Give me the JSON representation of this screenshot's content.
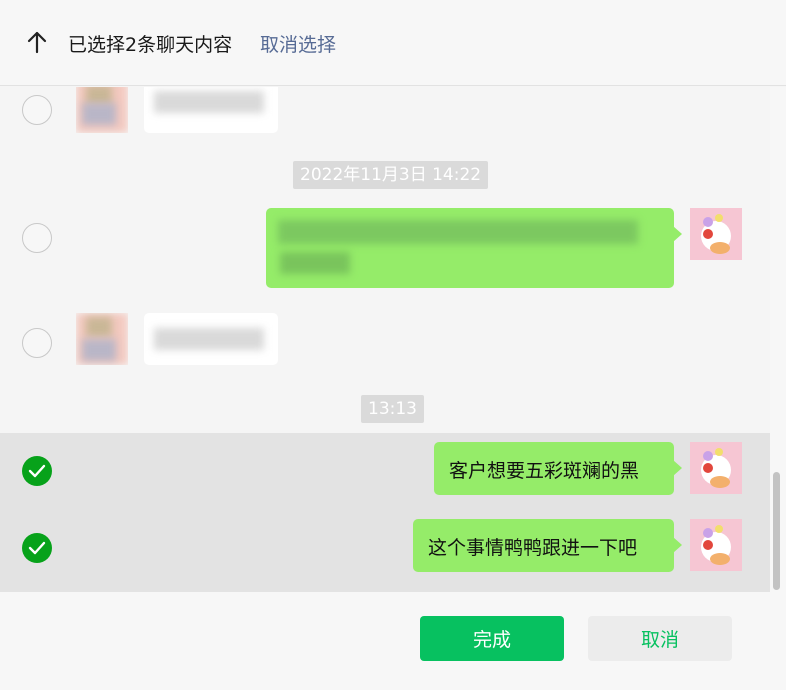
{
  "header": {
    "title": "已选择2条聊天内容",
    "cancel_select": "取消选择",
    "back_icon": "arrow-up-icon"
  },
  "chat": {
    "timestamps": [
      "2022年11月3日 14:22",
      "13:13"
    ],
    "messages": [
      {
        "side": "left",
        "text": "",
        "blurred": true,
        "selected": false
      },
      {
        "side": "right",
        "text": "",
        "blurred": true,
        "selected": false
      },
      {
        "side": "left",
        "text": "",
        "blurred": true,
        "selected": false
      },
      {
        "side": "right",
        "text": "客户想要五彩斑斓的黑",
        "blurred": false,
        "selected": true
      },
      {
        "side": "right",
        "text": "这个事情鸭鸭跟进一下吧",
        "blurred": false,
        "selected": true
      }
    ]
  },
  "footer": {
    "done": "完成",
    "cancel": "取消"
  },
  "colors": {
    "green_bubble": "#95ec69",
    "primary": "#07c160",
    "link": "#576b95",
    "check": "#07a21a"
  }
}
